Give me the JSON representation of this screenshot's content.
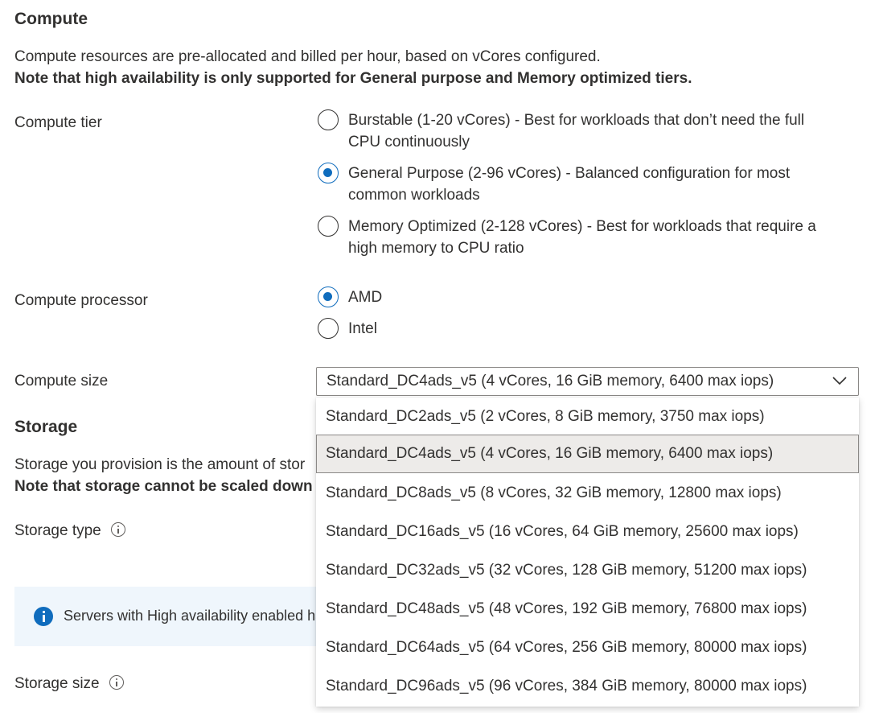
{
  "compute": {
    "heading": "Compute",
    "description": "Compute resources are pre-allocated and billed per hour, based on vCores configured.",
    "note": "Note that high availability is only supported for General purpose and Memory optimized tiers.",
    "tier_label": "Compute tier",
    "tiers": [
      {
        "line1": "Burstable (1-20 vCores) - Best for workloads that don’t need the full",
        "line2": "CPU continuously",
        "checked": false
      },
      {
        "line1": "General Purpose (2-96 vCores) - Balanced configuration for most",
        "line2": "common workloads",
        "checked": true
      },
      {
        "line1": "Memory Optimized (2-128 vCores) - Best for workloads that require a",
        "line2": "high memory to CPU ratio",
        "checked": false
      }
    ],
    "processor_label": "Compute processor",
    "processors": [
      {
        "label": "AMD",
        "checked": true
      },
      {
        "label": "Intel",
        "checked": false
      }
    ],
    "size_label": "Compute size",
    "size_selected": "Standard_DC4ads_v5 (4 vCores, 16 GiB memory, 6400 max iops)",
    "size_options": [
      "Standard_DC2ads_v5 (2 vCores, 8 GiB memory, 3750 max iops)",
      "Standard_DC4ads_v5 (4 vCores, 16 GiB memory, 6400 max iops)",
      "Standard_DC8ads_v5 (8 vCores, 32 GiB memory, 12800 max iops)",
      "Standard_DC16ads_v5 (16 vCores, 64 GiB memory, 25600 max iops)",
      "Standard_DC32ads_v5 (32 vCores, 128 GiB memory, 51200 max iops)",
      "Standard_DC48ads_v5 (48 vCores, 192 GiB memory, 76800 max iops)",
      "Standard_DC64ads_v5 (64 vCores, 256 GiB memory, 80000 max iops)",
      "Standard_DC96ads_v5 (96 vCores, 384 GiB memory, 80000 max iops)"
    ],
    "selected_index": 1
  },
  "storage": {
    "heading": "Storage",
    "description": "Storage you provision is the amount of stor",
    "note": "Note that storage cannot be scaled down",
    "type_label": "Storage type",
    "info_banner": "Servers with High availability enabled ha",
    "size_label": "Storage size"
  },
  "colors": {
    "accent": "#0f6cbd",
    "text": "#323130",
    "info_bg": "#eff6fc",
    "selected_bg": "#edebe9"
  }
}
